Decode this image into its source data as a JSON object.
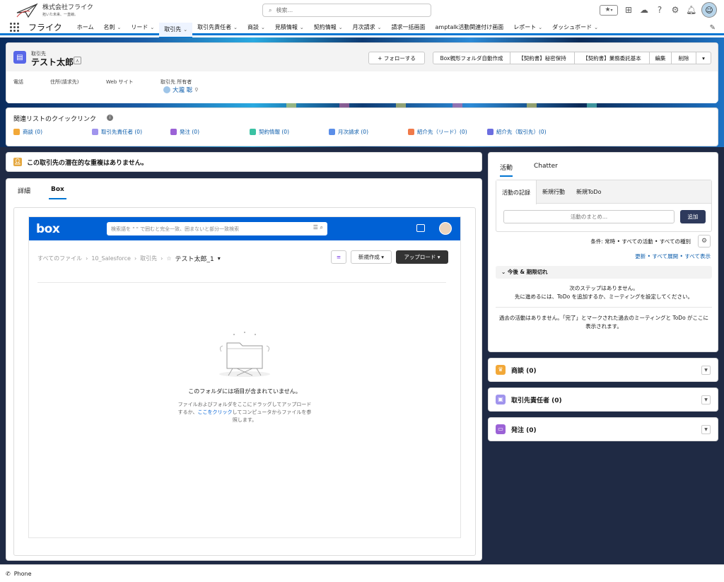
{
  "company": {
    "name": "株式会社フライク",
    "tagline": "拓いた未来、一直線。"
  },
  "search": {
    "placeholder": "検索..."
  },
  "nav": {
    "app": "フライク",
    "items": [
      {
        "label": "ホーム",
        "chev": false
      },
      {
        "label": "名刺",
        "chev": true
      },
      {
        "label": "リード",
        "chev": true
      },
      {
        "label": "取引先",
        "chev": true,
        "active": true
      },
      {
        "label": "取引先責任者",
        "chev": true
      },
      {
        "label": "商談",
        "chev": true
      },
      {
        "label": "見積情報",
        "chev": true
      },
      {
        "label": "契約情報",
        "chev": true
      },
      {
        "label": "月次請求",
        "chev": true
      },
      {
        "label": "請求一括画面",
        "chev": false
      },
      {
        "label": "amptalk活動関連付け画面",
        "chev": false
      },
      {
        "label": "レポート",
        "chev": true
      },
      {
        "label": "ダッシュボード",
        "chev": true
      }
    ]
  },
  "record": {
    "object": "取引先",
    "name": "テスト太郎",
    "buttons": [
      "+ フォローする",
      "Box親形フォルダ自動作成",
      "【契約書】秘密保持",
      "【契約書】業務委託基本",
      "編集",
      "削除"
    ],
    "fields": {
      "phone": "電話",
      "address": "住所(請求先)",
      "website": "Web サイト",
      "owner_label": "取引先 所有者",
      "owner": "大瀧 聡"
    }
  },
  "quicklinks": {
    "title": "関連リストのクイックリンク",
    "items": [
      {
        "label": "商談 (0)",
        "color": "#f2a838"
      },
      {
        "label": "取引先責任者 (0)",
        "color": "#a094ed"
      },
      {
        "label": "発注 (0)",
        "color": "#9b62d6"
      },
      {
        "label": "契約情報 (0)",
        "color": "#3bc2a3"
      },
      {
        "label": "月次請求 (0)",
        "color": "#5b8ee8"
      },
      {
        "label": "紹介先（リード）(0)",
        "color": "#f07a4a"
      },
      {
        "label": "紹介先（取引先）(0)",
        "color": "#6c6ee0"
      }
    ]
  },
  "duplicate": {
    "text": "この取引先の潜在的な重複はありません。"
  },
  "tabs": {
    "detail": "詳細",
    "box": "Box"
  },
  "box": {
    "logo": "box",
    "search_placeholder": "検索語を \" \" で囲むと完全一致、囲まないと部分一致検索",
    "crumbs": [
      "すべてのファイル",
      "10_Salesforce",
      "取引先"
    ],
    "current": "テスト太郎_1",
    "new": "新規作成",
    "upload": "アップロード",
    "empty_title": "このフォルダには項目が含まれていません。",
    "empty_text1": "ファイルおよびフォルダをここにドラッグしてアップロードするか、",
    "empty_link": "ここをクリック",
    "empty_text2": "してコンピュータからファイルを参照します。"
  },
  "activity": {
    "tab1": "活動",
    "tab2": "Chatter",
    "pubtabs": [
      "活動の記録",
      "新規行動",
      "新規ToDo"
    ],
    "input_placeholder": "活動のまとめ...",
    "add": "追加",
    "conditions": "条件: 常時 • すべての活動 • すべての種別",
    "links": "更新 • すべて展開 • すべて表示",
    "upcoming": "今後 & 期限切れ",
    "next1": "次のステップはありません。",
    "next2": "先に進めるには、ToDo を追加するか、ミーティングを設定してください。",
    "past": "過去の活動はありません。「完了」とマークされた過去のミーティングと ToDo がここに表示されます。"
  },
  "related": [
    {
      "label": "商談 (0)",
      "color": "#f2a838"
    },
    {
      "label": "取引先責任者 (0)",
      "color": "#a094ed"
    },
    {
      "label": "発注 (0)",
      "color": "#9b62d6"
    }
  ],
  "footer": {
    "label": "Phone"
  }
}
